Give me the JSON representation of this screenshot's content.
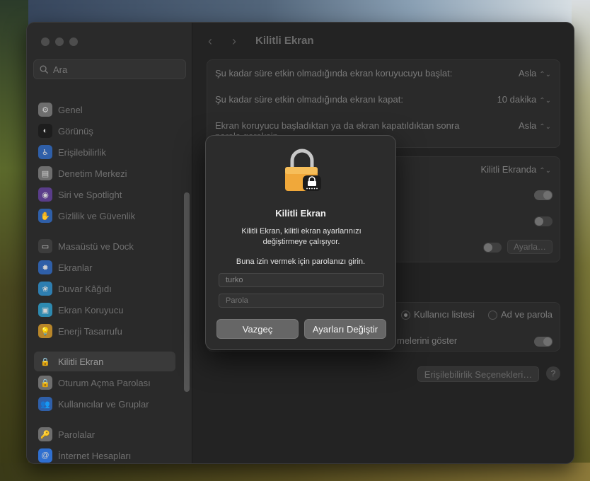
{
  "sidebar": {
    "search_placeholder": "Ara",
    "items": [
      {
        "label": "Genel",
        "icon": "gear-icon",
        "color": "#6e6e6e",
        "glyph": "⚙"
      },
      {
        "label": "Görünüş",
        "icon": "appearance-icon",
        "color": "#1d1d1d",
        "glyph": "◐"
      },
      {
        "label": "Erişilebilirlik",
        "icon": "accessibility-icon",
        "color": "#2f5fa8",
        "glyph": "♿"
      },
      {
        "label": "Denetim Merkezi",
        "icon": "control-center-icon",
        "color": "#6e6e6e",
        "glyph": "▤"
      },
      {
        "label": "Siri ve Spotlight",
        "icon": "siri-icon",
        "color": "#5a3d8a",
        "glyph": "◉"
      },
      {
        "label": "Gizlilik ve Güvenlik",
        "icon": "hand-icon",
        "color": "#2f5fa8",
        "glyph": "✋"
      },
      {
        "label": "Masaüstü ve Dock",
        "icon": "dock-icon",
        "color": "#3d3d3d",
        "glyph": "▭"
      },
      {
        "label": "Ekranlar",
        "icon": "display-icon",
        "color": "#2f5fa8",
        "glyph": "✹"
      },
      {
        "label": "Duvar Kâğıdı",
        "icon": "wallpaper-icon",
        "color": "#2e7eb0",
        "glyph": "❀"
      },
      {
        "label": "Ekran Koruyucu",
        "icon": "screensaver-icon",
        "color": "#2e8ab0",
        "glyph": "▣"
      },
      {
        "label": "Enerji Tasarrufu",
        "icon": "lightbulb-icon",
        "color": "#b8862a",
        "glyph": "💡"
      },
      {
        "label": "Kilitli Ekran",
        "icon": "lock-icon",
        "color": "#3a3a3a",
        "glyph": "🔒"
      },
      {
        "label": "Oturum Açma Parolası",
        "icon": "password-lock-icon",
        "color": "#6e6e6e",
        "glyph": "🔒"
      },
      {
        "label": "Kullanıcılar ve Gruplar",
        "icon": "users-icon",
        "color": "#2f5fa8",
        "glyph": "👥"
      },
      {
        "label": "Parolalar",
        "icon": "key-icon",
        "color": "#6e6e6e",
        "glyph": "🔑"
      },
      {
        "label": "İnternet Hesapları",
        "icon": "at-icon",
        "color": "#2f6fd0",
        "glyph": "@"
      }
    ],
    "selected_index": 11
  },
  "main": {
    "title": "Kilitli Ekran",
    "rows": {
      "screensaver_label": "Şu kadar süre etkin olmadığında ekran koruyucuyu başlat:",
      "screensaver_value": "Asla",
      "display_off_label": "Şu kadar süre etkin olmadığında ekranı kapat:",
      "display_off_value": "10 dakika",
      "require_pw_label_1": "Ekran koruyucu başladıktan ya da ekran kapatıldıktan sonra",
      "require_pw_label_2": "parola gereksin",
      "require_pw_value": "Asla",
      "lock_screen_value": "Kilitli Ekranda",
      "settings_button": "Ayarla…",
      "user_list_label": "Kullanıcı listesi",
      "name_password_label": "Ad ve parola",
      "show_hints_label": "melerini göster",
      "accessibility_options_button": "Erişilebilirlik Seçenekleri…",
      "help_button": "?"
    }
  },
  "dialog": {
    "title": "Kilitli Ekran",
    "message": "Kilitli Ekran, kilitli ekran ayarlarınızı değiştirmeye çalışıyor.",
    "prompt": "Buna izin vermek için parolanızı girin.",
    "username_value": "turko",
    "password_placeholder": "Parola",
    "cancel_button": "Vazgeç",
    "confirm_button": "Ayarları Değiştir"
  }
}
